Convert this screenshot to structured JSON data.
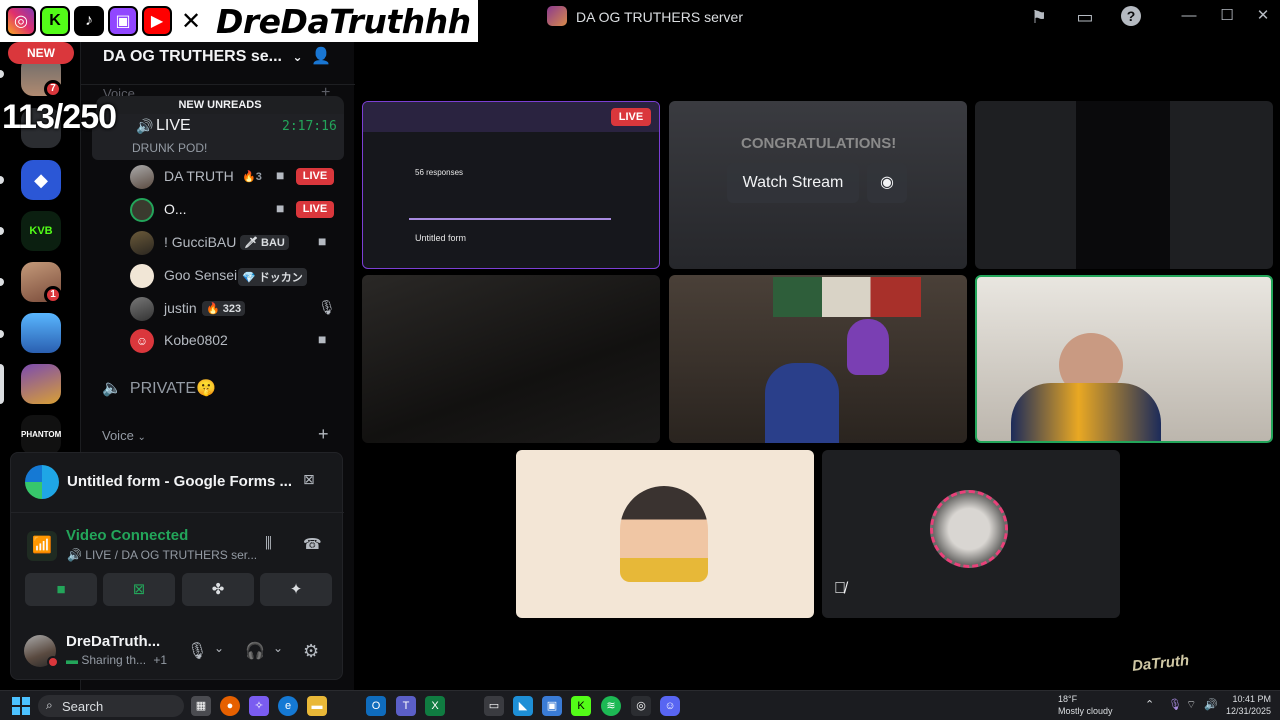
{
  "overlay": {
    "name": "DreDaTruthhh",
    "socials": [
      "instagram-icon",
      "kick-icon",
      "tiktok-icon",
      "twitch-icon",
      "youtube-icon",
      "x-icon"
    ]
  },
  "counter": "113/250",
  "titlebar": {
    "server_title": "DA OG TRUTHERS server",
    "icons": [
      "inbox-flag-icon",
      "inbox-icon",
      "help-icon"
    ]
  },
  "rail": {
    "new_label": "NEW",
    "badges": [
      "7",
      "1"
    ],
    "kvb_label": "KVB",
    "phantoms_label": "PHANTOMS"
  },
  "sidebar": {
    "server_name": "DA OG TRUTHERS se...",
    "faint_category": "Voice",
    "new_unreads": "NEW UNREADS",
    "live_channel": {
      "name": "LIVE",
      "timer": "2:17:16",
      "status": "DRUNK POD!"
    },
    "users": [
      {
        "name": "DA TRUTH",
        "tag": "3",
        "live": "LIVE"
      },
      {
        "name": "O...",
        "live": "LIVE"
      },
      {
        "name": "! GucciBAU",
        "tag": "BAU"
      },
      {
        "name": "Goo Sensei",
        "tag": "ドッカン"
      },
      {
        "name": "justin",
        "tag": "323"
      },
      {
        "name": "Kobe0802"
      }
    ],
    "private_channel": "PRIVATE🤫",
    "voice_category": "Voice"
  },
  "panel": {
    "stream_title": "Untitled form - Google Forms ...",
    "connection_title": "Video Connected",
    "connection_sub": "LIVE / DA OG TRUTHERS ser...",
    "user_name": "DreDaTruth...",
    "user_status": "Sharing th...",
    "user_extra": "+1"
  },
  "stage": {
    "live_badge": "LIVE",
    "watch_label": "Watch Stream",
    "form_responses": "56 responses",
    "form_title": "Untitled form",
    "congrats": "CONGRATULATIONS!"
  },
  "watermark": "DaTruth",
  "taskbar": {
    "search_label": "Search",
    "weather_temp": "18°F",
    "weather_desc": "Mostly cloudy",
    "time": "10:41 PM",
    "date": "12/31/2025"
  },
  "colors": {
    "live_red": "#da373c",
    "connected_green": "#23a55a",
    "background": "#000000"
  }
}
